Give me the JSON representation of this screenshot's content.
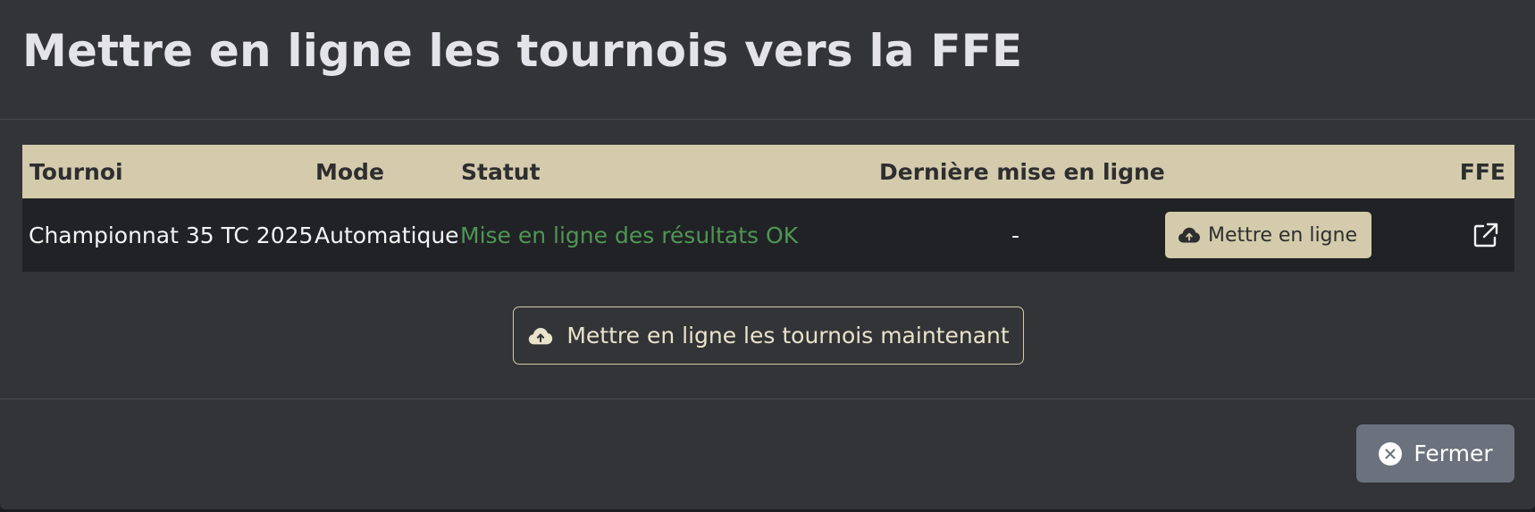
{
  "modal": {
    "title": "Mettre en ligne les tournois vers la FFE"
  },
  "table": {
    "headers": {
      "tournament": "Tournoi",
      "mode": "Mode",
      "status": "Statut",
      "last_upload": "Dernière mise en ligne",
      "ffe": "FFE"
    },
    "rows": [
      {
        "tournament": "Championnat 35 TC 2025",
        "mode": "Automatique",
        "status": "Mise en ligne des résultats OK",
        "last_upload": "-",
        "upload_button_label": "Mettre en ligne"
      }
    ]
  },
  "upload_all_button": {
    "label": "Mettre en ligne les tournois maintenant"
  },
  "footer": {
    "close_label": "Fermer"
  },
  "icons": {
    "upload": "cloud-upload-icon",
    "external_link": "external-link-icon",
    "close": "close-circle-icon"
  },
  "colors": {
    "accent": "#d3cbab",
    "status_ok": "#4f9653",
    "close_button": "#6c727d",
    "modal_bg": "#333437",
    "row_bg": "#212226"
  }
}
